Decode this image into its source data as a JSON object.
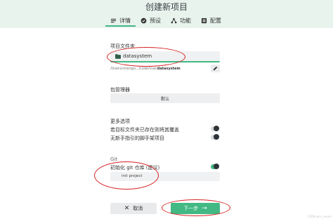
{
  "header": {
    "title": "创建新项目",
    "tabs": [
      {
        "label": "详情",
        "icon": "list-icon",
        "active": true
      },
      {
        "label": "预设",
        "icon": "check-circle-icon",
        "active": false
      },
      {
        "label": "功能",
        "icon": "branch-icon",
        "active": false
      },
      {
        "label": "配置",
        "icon": "config-icon",
        "active": false
      }
    ]
  },
  "folder": {
    "label": "项目文件夹",
    "value": "datasystem",
    "path_prefix": "/Users/chengo.../code/vue/",
    "path_name": "datasystem"
  },
  "package_manager": {
    "label": "包管理器",
    "value": "默认"
  },
  "more_options": {
    "label": "更多选项",
    "overwrite_label": "若目标文件夹已存在则将其覆盖",
    "overwrite_on": false,
    "no_guide_label": "无新手指引的脚手架项目",
    "no_guide_on": false
  },
  "git": {
    "label": "Git",
    "init_label": "初始化 git 仓库 (建议)",
    "init_on": true,
    "commit_placeholder": "init project"
  },
  "actions": {
    "cancel_label": "取消",
    "next_label": "下一步"
  },
  "watermark": "CSDN @m_seven",
  "colors": {
    "accent": "#42b883",
    "header_bg": "#e8f3ee",
    "annotation": "#d42121"
  }
}
